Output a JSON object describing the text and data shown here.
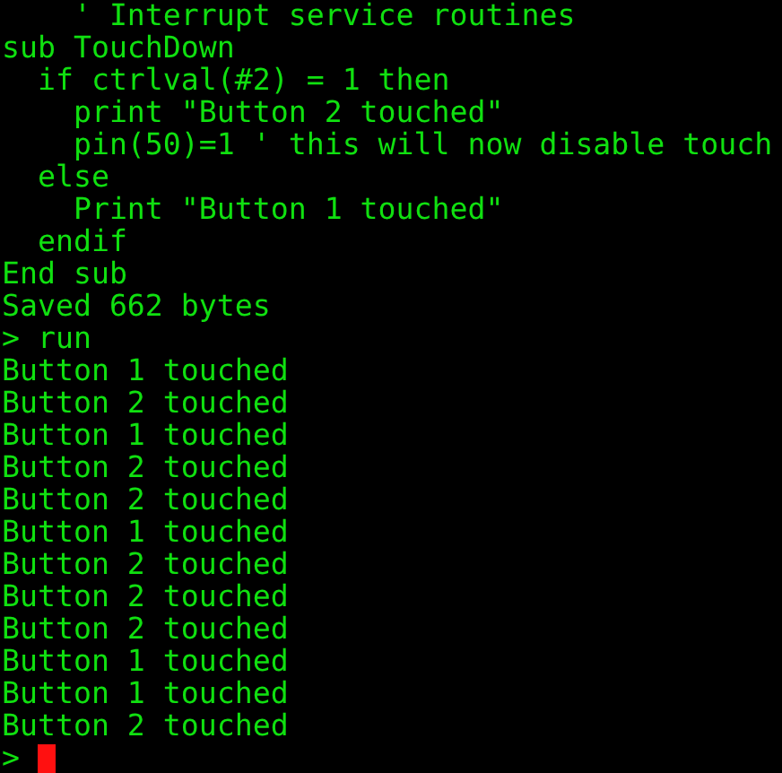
{
  "terminal": {
    "lines": [
      {
        "text": "    ' Interrupt service routines"
      },
      {
        "text": "sub TouchDown"
      },
      {
        "text": "  if ctrlval(#2) = 1 then"
      },
      {
        "text": "    print \"Button 2 touched\""
      },
      {
        "text": "    pin(50)=1 ' this will now disable touch"
      },
      {
        "text": "  else"
      },
      {
        "text": "    Print \"Button 1 touched\""
      },
      {
        "text": "  endif"
      },
      {
        "text": "End sub"
      },
      {
        "text": "Saved 662 bytes"
      },
      {
        "text": "> run"
      },
      {
        "text": "Button 1 touched"
      },
      {
        "text": "Button 2 touched"
      },
      {
        "text": "Button 1 touched"
      },
      {
        "text": "Button 2 touched"
      },
      {
        "text": "Button 2 touched"
      },
      {
        "text": "Button 1 touched"
      },
      {
        "text": "Button 2 touched"
      },
      {
        "text": "Button 2 touched"
      },
      {
        "text": "Button 2 touched"
      },
      {
        "text": "Button 1 touched"
      },
      {
        "text": "Button 1 touched"
      },
      {
        "text": "Button 2 touched"
      }
    ],
    "prompt": {
      "text": ">",
      "cursor": true
    }
  }
}
